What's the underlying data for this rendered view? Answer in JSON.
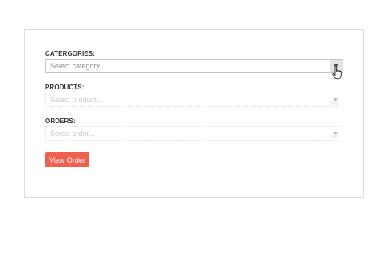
{
  "form": {
    "categories": {
      "label": "CATERGORIES:",
      "placeholder": "Select category...",
      "icon": "chevron-down-icon"
    },
    "products": {
      "label": "PRODUCTS:",
      "placeholder": "Select product...",
      "icon": "chevron-down-icon"
    },
    "orders": {
      "label": "ORDERS:",
      "placeholder": "Select order...",
      "icon": "chevron-down-icon"
    },
    "view_order_label": "View Order"
  },
  "colors": {
    "accent_button": "#f0604f",
    "panel_border": "#dcdcdc",
    "dropdown_button_bg": "#e4e4e4"
  },
  "cursor_icon": "hand-pointer-icon"
}
